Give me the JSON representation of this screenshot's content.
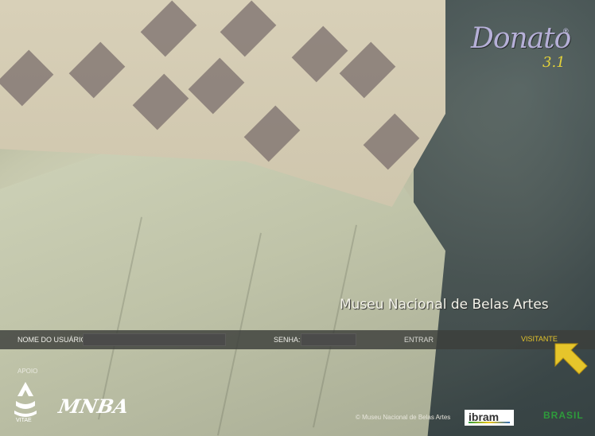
{
  "logo": {
    "name": "Donato",
    "registered": "®",
    "version": "3.1"
  },
  "museum_title": "Museu Nacional de Belas Artes",
  "login": {
    "username_label": "NOME DO USUÁRIO:",
    "username_value": "",
    "password_label": "SENHA:",
    "password_value": "",
    "enter_label": "ENTRAR",
    "visitor_label": "VISITANTE"
  },
  "sponsors": {
    "apoio_label": "APOIO",
    "vitae_label": "VITAE",
    "mnba_label": "MNBA"
  },
  "footer": {
    "copyright": "© Museu Nacional de Belas Artes",
    "ibram_label": "ibram",
    "brasil_label": "BRASIL"
  },
  "colors": {
    "accent": "#e6c52b",
    "bar": "#3c3e3a",
    "logo": "#b6b0d8"
  },
  "icons": {
    "arrow": "arrow-up-left-icon",
    "vitae": "vitae-logo-icon"
  }
}
